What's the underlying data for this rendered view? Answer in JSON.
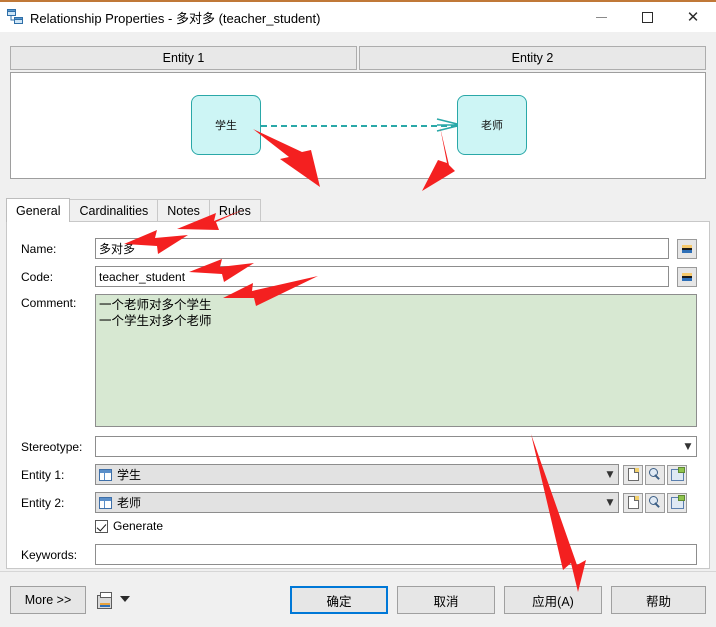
{
  "window": {
    "title": "Relationship Properties - 多对多 (teacher_student)",
    "icon": "relationship-icon",
    "controls": {
      "minimize": "–",
      "maximize": "▢",
      "close": "✕"
    }
  },
  "entity_headers": [
    {
      "label": "Entity 1"
    },
    {
      "label": "Entity 2"
    }
  ],
  "diagram": {
    "entity1_label": "学生",
    "entity2_label": "老师",
    "link_style": "dashed",
    "link_color": "#2aa8a8",
    "entity_fill": "#cdf5f5",
    "entity_border": "#2aa8a8",
    "cardinality_symbol": "crow-foot"
  },
  "tabs": [
    {
      "label": "General",
      "active": true
    },
    {
      "label": "Cardinalities",
      "active": false
    },
    {
      "label": "Notes",
      "active": false
    },
    {
      "label": "Rules",
      "active": false
    }
  ],
  "form": {
    "name": {
      "label": "Name:",
      "value": "多对多"
    },
    "code": {
      "label": "Code:",
      "value": "teacher_student"
    },
    "comment": {
      "label": "Comment:",
      "value": "一个老师对多个学生\n一个学生对多个老师",
      "background": "#d7e8d2"
    },
    "stereotype": {
      "label": "Stereotype:",
      "value": "",
      "placeholder": ""
    },
    "entity1": {
      "label": "Entity 1:",
      "value": "学生"
    },
    "entity2": {
      "label": "Entity 2:",
      "value": "老师"
    },
    "generate": {
      "label": "Generate",
      "checked": true
    },
    "keywords": {
      "label": "Keywords:",
      "value": "",
      "placeholder": ""
    },
    "row_buttons": [
      {
        "name": "create-icon",
        "title": "Create"
      },
      {
        "name": "browse-icon",
        "title": "Browse"
      },
      {
        "name": "properties-icon",
        "title": "Properties"
      }
    ],
    "equals_button_label": "="
  },
  "footer": {
    "more": "More >>",
    "print": "print-icon",
    "print_caret": "chevron-down-icon",
    "ok": "确定",
    "cancel": "取消",
    "apply": "应用(A)",
    "help": "帮助",
    "default_button": "确定",
    "accent": "#0078d7"
  },
  "annotations": {
    "color": "#f42020",
    "arrows": [
      {
        "target": "entity1-box",
        "points_to": "学生 entity box"
      },
      {
        "target": "entity2-box",
        "points_to": "老师 entity box"
      },
      {
        "target": "rules-tab",
        "points_to": "Rules tab"
      },
      {
        "target": "name-field",
        "points_to": "Name input"
      },
      {
        "target": "code-field",
        "points_to": "Code input"
      },
      {
        "target": "comment-field",
        "points_to": "Comment textarea"
      },
      {
        "target": "apply-button",
        "points_to": "应用(A) button"
      }
    ]
  }
}
